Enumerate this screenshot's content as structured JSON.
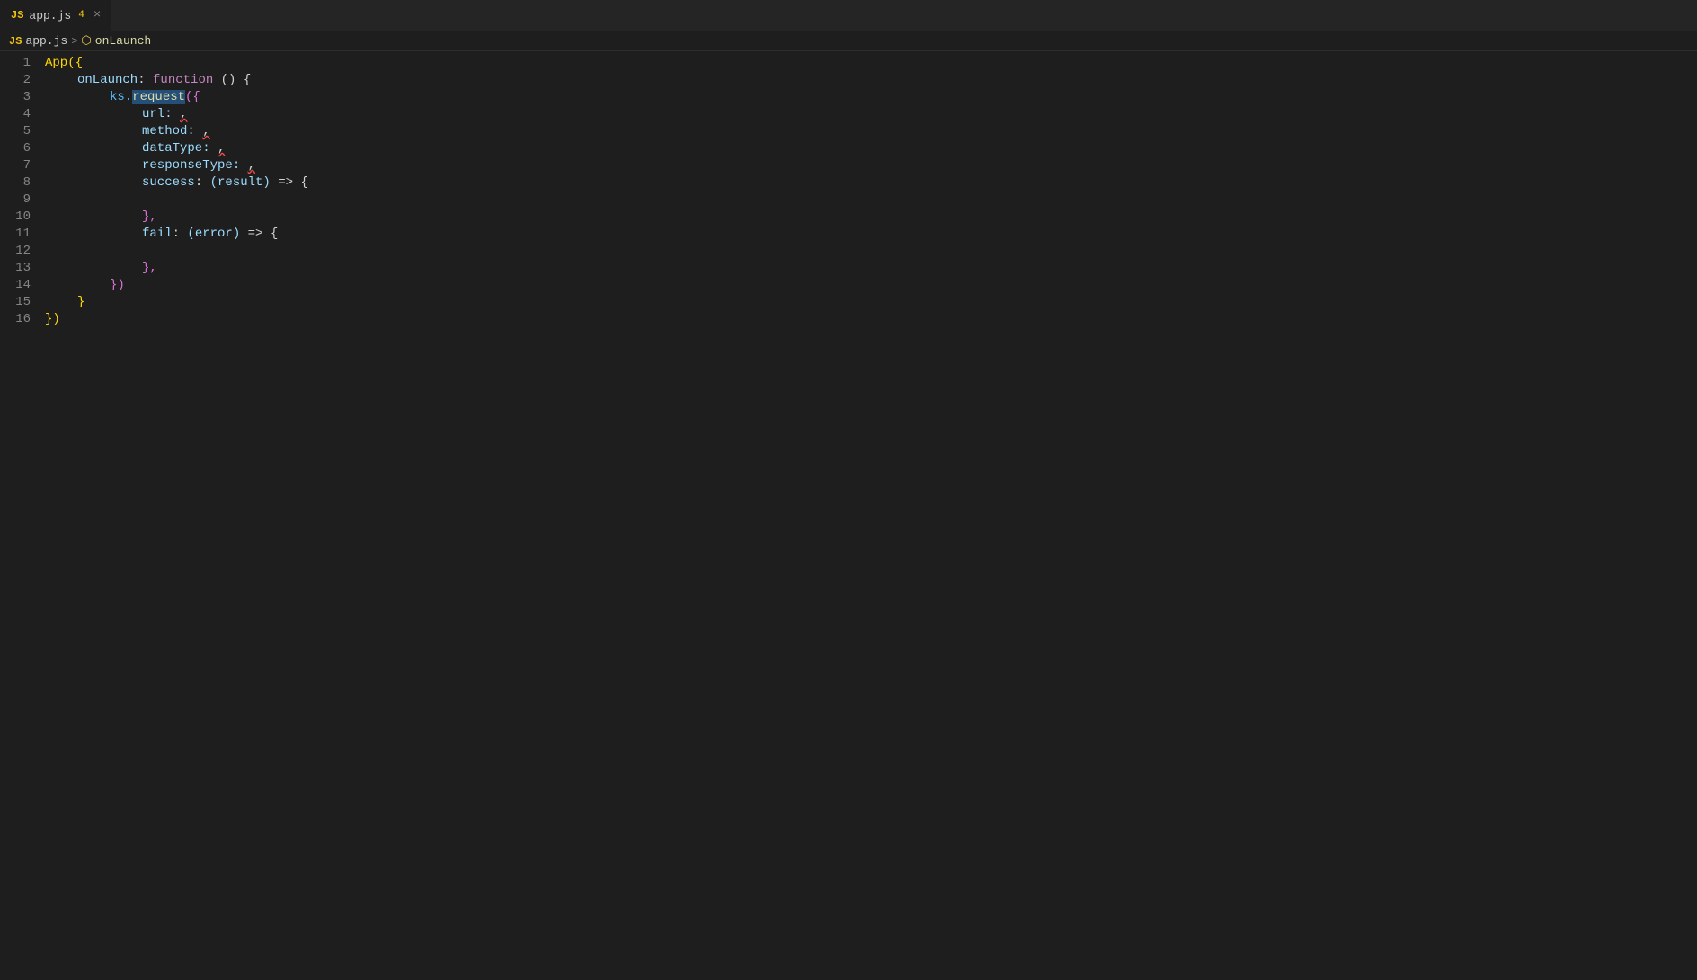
{
  "tab": {
    "icon": "JS",
    "filename": "app.js",
    "badge": "4",
    "close": "×"
  },
  "breadcrumb": {
    "icon": "JS",
    "file": "app.js",
    "separator": ">",
    "function_icon": "⬡",
    "function_name": "onLaunch"
  },
  "lines": [
    {
      "num": "1",
      "tokens": [
        {
          "t": "App({",
          "c": "c-brace2"
        }
      ]
    },
    {
      "num": "2",
      "tokens": [
        {
          "t": "    onLaunch",
          "c": "c-prop"
        },
        {
          "t": ": ",
          "c": "c-colon"
        },
        {
          "t": "function",
          "c": "c-keyword"
        },
        {
          "t": " () {",
          "c": "c-white"
        }
      ]
    },
    {
      "num": "3",
      "tokens": [
        {
          "t": "        ks.",
          "c": "c-cyan"
        },
        {
          "t": "request",
          "c": "c-function"
        },
        {
          "t": "({",
          "c": "c-brace"
        }
      ]
    },
    {
      "num": "4",
      "tokens": [
        {
          "t": "            url: ",
          "c": "c-prop"
        },
        {
          "t": ",",
          "c": "c-white",
          "squiggly": true
        }
      ]
    },
    {
      "num": "5",
      "tokens": [
        {
          "t": "            method: ",
          "c": "c-prop"
        },
        {
          "t": ",",
          "c": "c-white",
          "squiggly": true
        }
      ]
    },
    {
      "num": "6",
      "tokens": [
        {
          "t": "            dataType: ",
          "c": "c-prop"
        },
        {
          "t": ",",
          "c": "c-white",
          "squiggly": true
        }
      ]
    },
    {
      "num": "7",
      "tokens": [
        {
          "t": "            responseType: ",
          "c": "c-prop"
        },
        {
          "t": ",",
          "c": "c-white",
          "squiggly": true
        }
      ]
    },
    {
      "num": "8",
      "tokens": [
        {
          "t": "            success",
          "c": "c-prop"
        },
        {
          "t": ": ",
          "c": "c-colon"
        },
        {
          "t": "(result)",
          "c": "c-param"
        },
        {
          "t": " => {",
          "c": "c-white"
        }
      ]
    },
    {
      "num": "9",
      "tokens": [
        {
          "t": "",
          "c": "c-white"
        }
      ]
    },
    {
      "num": "10",
      "tokens": [
        {
          "t": "            },",
          "c": "c-brace"
        }
      ]
    },
    {
      "num": "11",
      "tokens": [
        {
          "t": "            fail",
          "c": "c-prop"
        },
        {
          "t": ": ",
          "c": "c-colon"
        },
        {
          "t": "(error)",
          "c": "c-param"
        },
        {
          "t": " => {",
          "c": "c-white"
        }
      ]
    },
    {
      "num": "12",
      "tokens": [
        {
          "t": "",
          "c": "c-white"
        }
      ]
    },
    {
      "num": "13",
      "tokens": [
        {
          "t": "            },",
          "c": "c-brace"
        }
      ]
    },
    {
      "num": "14",
      "tokens": [
        {
          "t": "        })",
          "c": "c-brace"
        }
      ]
    },
    {
      "num": "15",
      "tokens": [
        {
          "t": "    }",
          "c": "c-brace2"
        }
      ]
    },
    {
      "num": "16",
      "tokens": [
        {
          "t": "})",
          "c": "c-brace2"
        }
      ]
    }
  ]
}
